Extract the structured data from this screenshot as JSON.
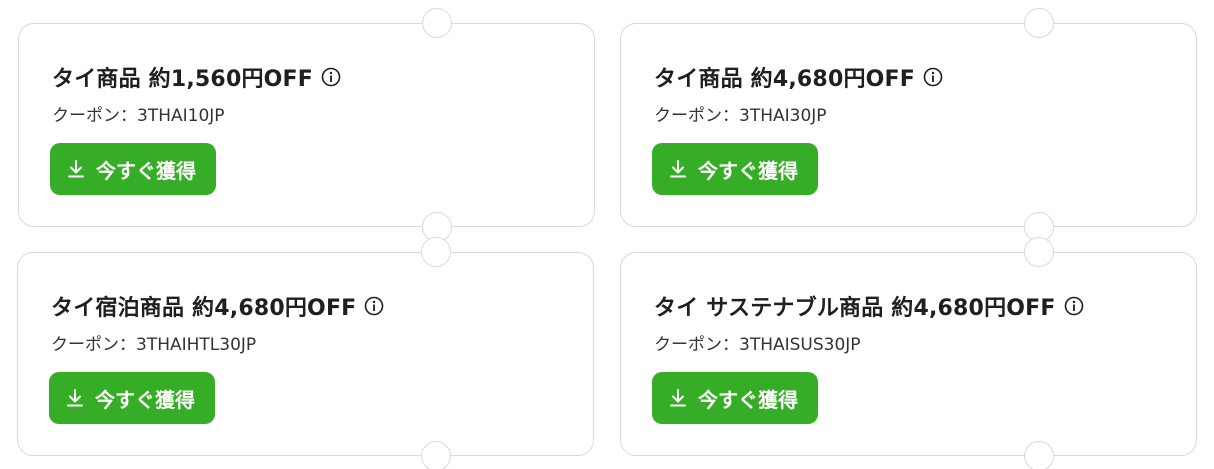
{
  "coupons": [
    {
      "title": "タイ商品 約1,560円OFF",
      "code_label": "クーポン：3THAI10JP",
      "button_label": "今すぐ獲得"
    },
    {
      "title": "タイ商品 約4,680円OFF",
      "code_label": "クーポン：3THAI30JP",
      "button_label": "今すぐ獲得"
    },
    {
      "title": "タイ宿泊商品 約4,680円OFF",
      "code_label": "クーポン：3THAIHTL30JP",
      "button_label": "今すぐ獲得"
    },
    {
      "title": "タイ サステナブル商品 約4,680円OFF",
      "code_label": "クーポン：3THAISUS30JP",
      "button_label": "今すぐ獲得"
    }
  ],
  "colors": {
    "button": "#36ad26",
    "border": "#d9d9d9",
    "title": "#1f1f1f"
  },
  "icons": {
    "info": "info-icon",
    "download": "download-icon"
  }
}
